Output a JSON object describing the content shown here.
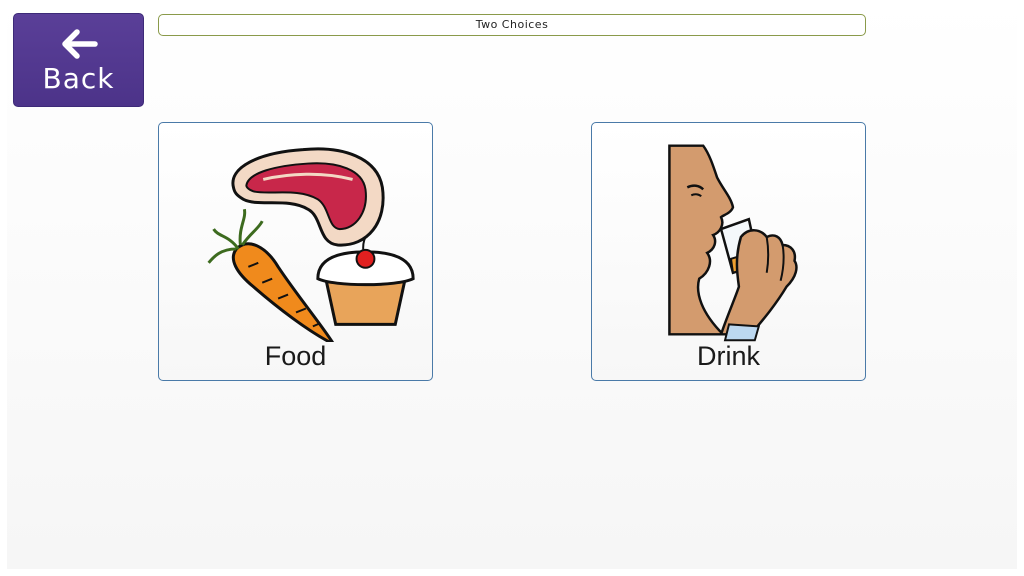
{
  "back_button": {
    "label": "Back",
    "icon": "arrow-left-icon"
  },
  "title_bar": {
    "text": "Two Choices"
  },
  "choices": [
    {
      "label": "Food",
      "icon": "food-icon"
    },
    {
      "label": "Drink",
      "icon": "drinking-person-icon"
    }
  ],
  "colors": {
    "back_button_bg": "#5a3f98",
    "title_border": "#8a9a4a",
    "card_border": "#4a7aa8"
  }
}
